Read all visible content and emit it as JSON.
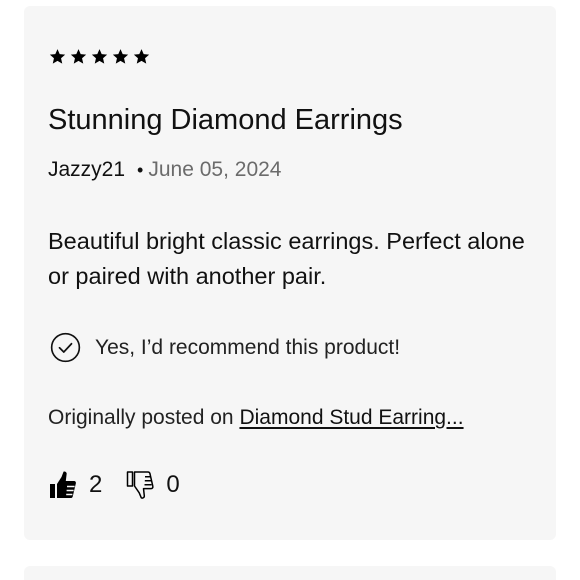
{
  "review": {
    "rating": 5,
    "rating_max": 5,
    "title": "Stunning Diamond Earrings",
    "author": "Jazzy21",
    "separator": "•",
    "date": "June 05, 2024",
    "body": "Beautiful bright classic earrings. Perfect alone or paired with another pair.",
    "recommendation": "Yes, I’d recommend this product!",
    "origin_prefix": "Originally posted on ",
    "origin_link": "Diamond Stud Earring...",
    "helpful_count": "2",
    "unhelpful_count": "0"
  },
  "icons": {
    "star": "star-icon",
    "recommend": "check-circle-icon",
    "helpful": "thumbs-up-icon",
    "unhelpful": "thumbs-down-icon"
  },
  "colors": {
    "card_background": "#f6f6f6",
    "text": "#111111",
    "muted_text": "#6b6b6b"
  }
}
